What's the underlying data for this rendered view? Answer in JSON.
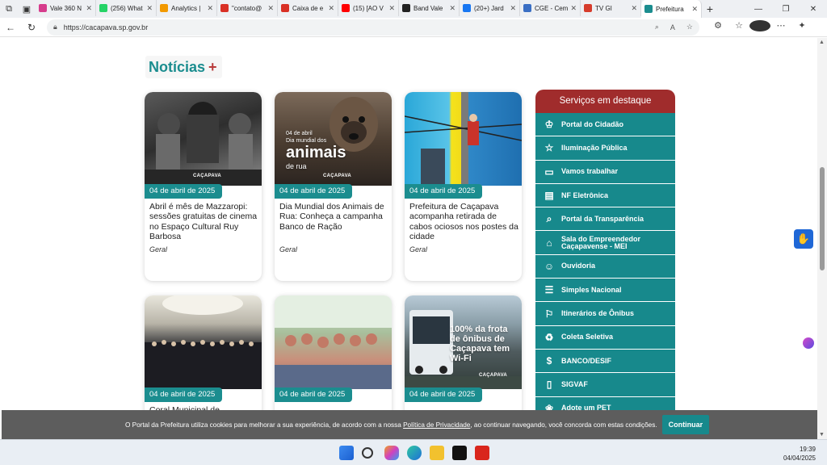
{
  "browser": {
    "tabs": [
      {
        "label": "Vale 360 N",
        "color": "#d63c8c"
      },
      {
        "label": "(256) What",
        "color": "#25d366"
      },
      {
        "label": "Analytics |",
        "color": "#f29900"
      },
      {
        "label": "\"contato@",
        "color": "#d93025"
      },
      {
        "label": "Caixa de e",
        "color": "#d93025"
      },
      {
        "label": "(15) [AO V",
        "color": "#ff0000"
      },
      {
        "label": "Band Vale",
        "color": "#222222"
      },
      {
        "label": "(20+) Jard",
        "color": "#1877f2"
      },
      {
        "label": "CGE - Cem",
        "color": "#3a6fc4"
      },
      {
        "label": "TV GI",
        "color": "#d63c2c"
      },
      {
        "label": "Prefeitura",
        "color": "#1b8d8f"
      }
    ],
    "url": "https://cacapava.sp.gov.br"
  },
  "news": {
    "heading": "Notícias",
    "plus": "+",
    "cards": [
      {
        "date": "04 de abril de 2025",
        "title": "Abril é mês de Mazzaropi: sessões gratuitas de cinema no Espaço Cultural Ruy Barbosa",
        "category": "Geral"
      },
      {
        "date": "04 de abril de 2025",
        "title": "Dia Mundial dos Animais de Rua: Conheça a campanha Banco de Ração",
        "category": "Geral",
        "overlay": {
          "line1": "04 de abril",
          "line2": "Dia mundial dos",
          "line3": "animais",
          "line4": "de rua"
        }
      },
      {
        "date": "04 de abril de 2025",
        "title": "Prefeitura de Caçapava acompanha retirada de cabos ociosos nos postes da cidade",
        "category": "Geral"
      },
      {
        "date": "04 de abril de 2025",
        "title": "Coral Municipal de",
        "category": ""
      },
      {
        "date": "04 de abril de 2025",
        "title": "",
        "category": ""
      },
      {
        "date": "04 de abril de 2025",
        "title": "",
        "category": "",
        "overlay": {
          "line1": "100% da frota",
          "line2": "de ônibus de",
          "line3": "Caçapava tem",
          "line4": "Wi-Fi"
        }
      }
    ],
    "logo_text": "CAÇAPAVA"
  },
  "services": {
    "heading": "Serviços em destaque",
    "items": [
      {
        "label": "Portal do Cidadão",
        "icon": "citizen-icon",
        "glyph": "♔"
      },
      {
        "label": "Iluminação Pública",
        "icon": "star-icon",
        "glyph": "☆"
      },
      {
        "label": "Vamos trabalhar",
        "icon": "briefcase-icon",
        "glyph": "▭"
      },
      {
        "label": "NF Eletrônica",
        "icon": "document-icon",
        "glyph": "▤"
      },
      {
        "label": "Portal da Transparência",
        "icon": "search-icon",
        "glyph": "⌕"
      },
      {
        "label": "Sala do Empreendedor Caçapavense - MEI",
        "icon": "store-icon",
        "glyph": "⌂"
      },
      {
        "label": "Ouvidoria",
        "icon": "ombudsman-icon",
        "glyph": "☺"
      },
      {
        "label": "Simples Nacional",
        "icon": "checklist-icon",
        "glyph": "☰"
      },
      {
        "label": "Itinerários de Ônibus",
        "icon": "bus-icon",
        "glyph": "⚐"
      },
      {
        "label": "Coleta Seletiva",
        "icon": "recycle-icon",
        "glyph": "♻"
      },
      {
        "label": "BANCO/DESIF",
        "icon": "money-icon",
        "glyph": "$"
      },
      {
        "label": "SIGVAF",
        "icon": "file-icon",
        "glyph": "▯"
      },
      {
        "label": "Adote um PET",
        "icon": "pet-icon",
        "glyph": "❀"
      }
    ]
  },
  "cookie": {
    "text_before": "O Portal da Prefeitura utiliza cookies para melhorar a sua experiência, de acordo com a nossa ",
    "link": "Política de Privacidade",
    "text_after": ", ao continuar navegando, você concorda com estas condições.",
    "button": "Continuar"
  },
  "taskbar": {
    "time": "19:39",
    "date": "04/04/2025"
  }
}
